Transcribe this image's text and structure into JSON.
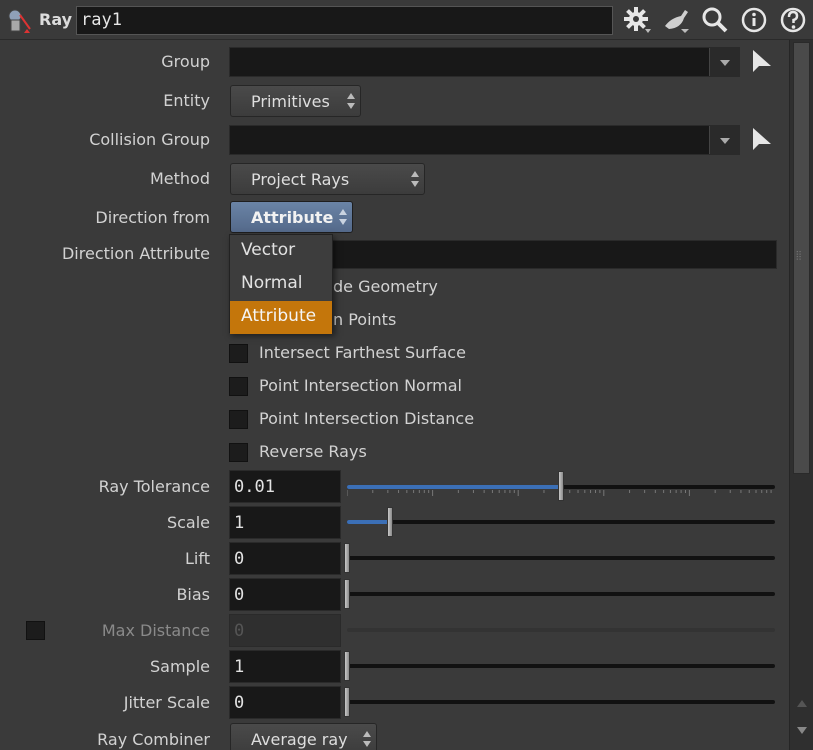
{
  "header": {
    "node_type": "Ray",
    "node_name": "ray1",
    "icons": [
      "ray-node-icon",
      "gear-icon",
      "brush-icon",
      "search-icon",
      "info-icon",
      "help-icon"
    ]
  },
  "params": {
    "group_label": "Group",
    "group_value": "",
    "entity_label": "Entity",
    "entity_value": "Primitives",
    "collision_group_label": "Collision Group",
    "collision_group_value": "",
    "method_label": "Method",
    "method_value": "Project Rays",
    "direction_from_label": "Direction from",
    "direction_from_value": "Attribute",
    "direction_attribute_label": "Direction Attribute",
    "direction_attribute_value": "",
    "cb_geometry_partial": "de Geometry",
    "cb_points_partial": "n Points",
    "cb_intersect_farthest": "Intersect Farthest Surface",
    "cb_point_normal": "Point Intersection Normal",
    "cb_point_distance": "Point Intersection Distance",
    "cb_reverse": "Reverse Rays",
    "ray_tolerance_label": "Ray Tolerance",
    "ray_tolerance_value": "0.01",
    "scale_label": "Scale",
    "scale_value": "1",
    "lift_label": "Lift",
    "lift_value": "0",
    "bias_label": "Bias",
    "bias_value": "0",
    "max_distance_label": "Max Distance",
    "max_distance_value": "0",
    "sample_label": "Sample",
    "sample_value": "1",
    "jitter_scale_label": "Jitter Scale",
    "jitter_scale_value": "0",
    "ray_combiner_label": "Ray Combiner",
    "ray_combiner_value": "Average ray"
  },
  "popup": {
    "options": [
      "Vector",
      "Normal",
      "Attribute"
    ],
    "selected": "Attribute"
  },
  "sliders": {
    "ray_tolerance_fraction": 0.5,
    "scale_fraction": 0.1,
    "lift_fraction": 0.0,
    "bias_fraction": 0.0,
    "sample_fraction": 0.0,
    "jitter_scale_fraction": 0.0
  },
  "colors": {
    "accent_selected": "#c4760b",
    "slider_fill": "#3b6fb6",
    "active_menu": "#5b7493"
  }
}
